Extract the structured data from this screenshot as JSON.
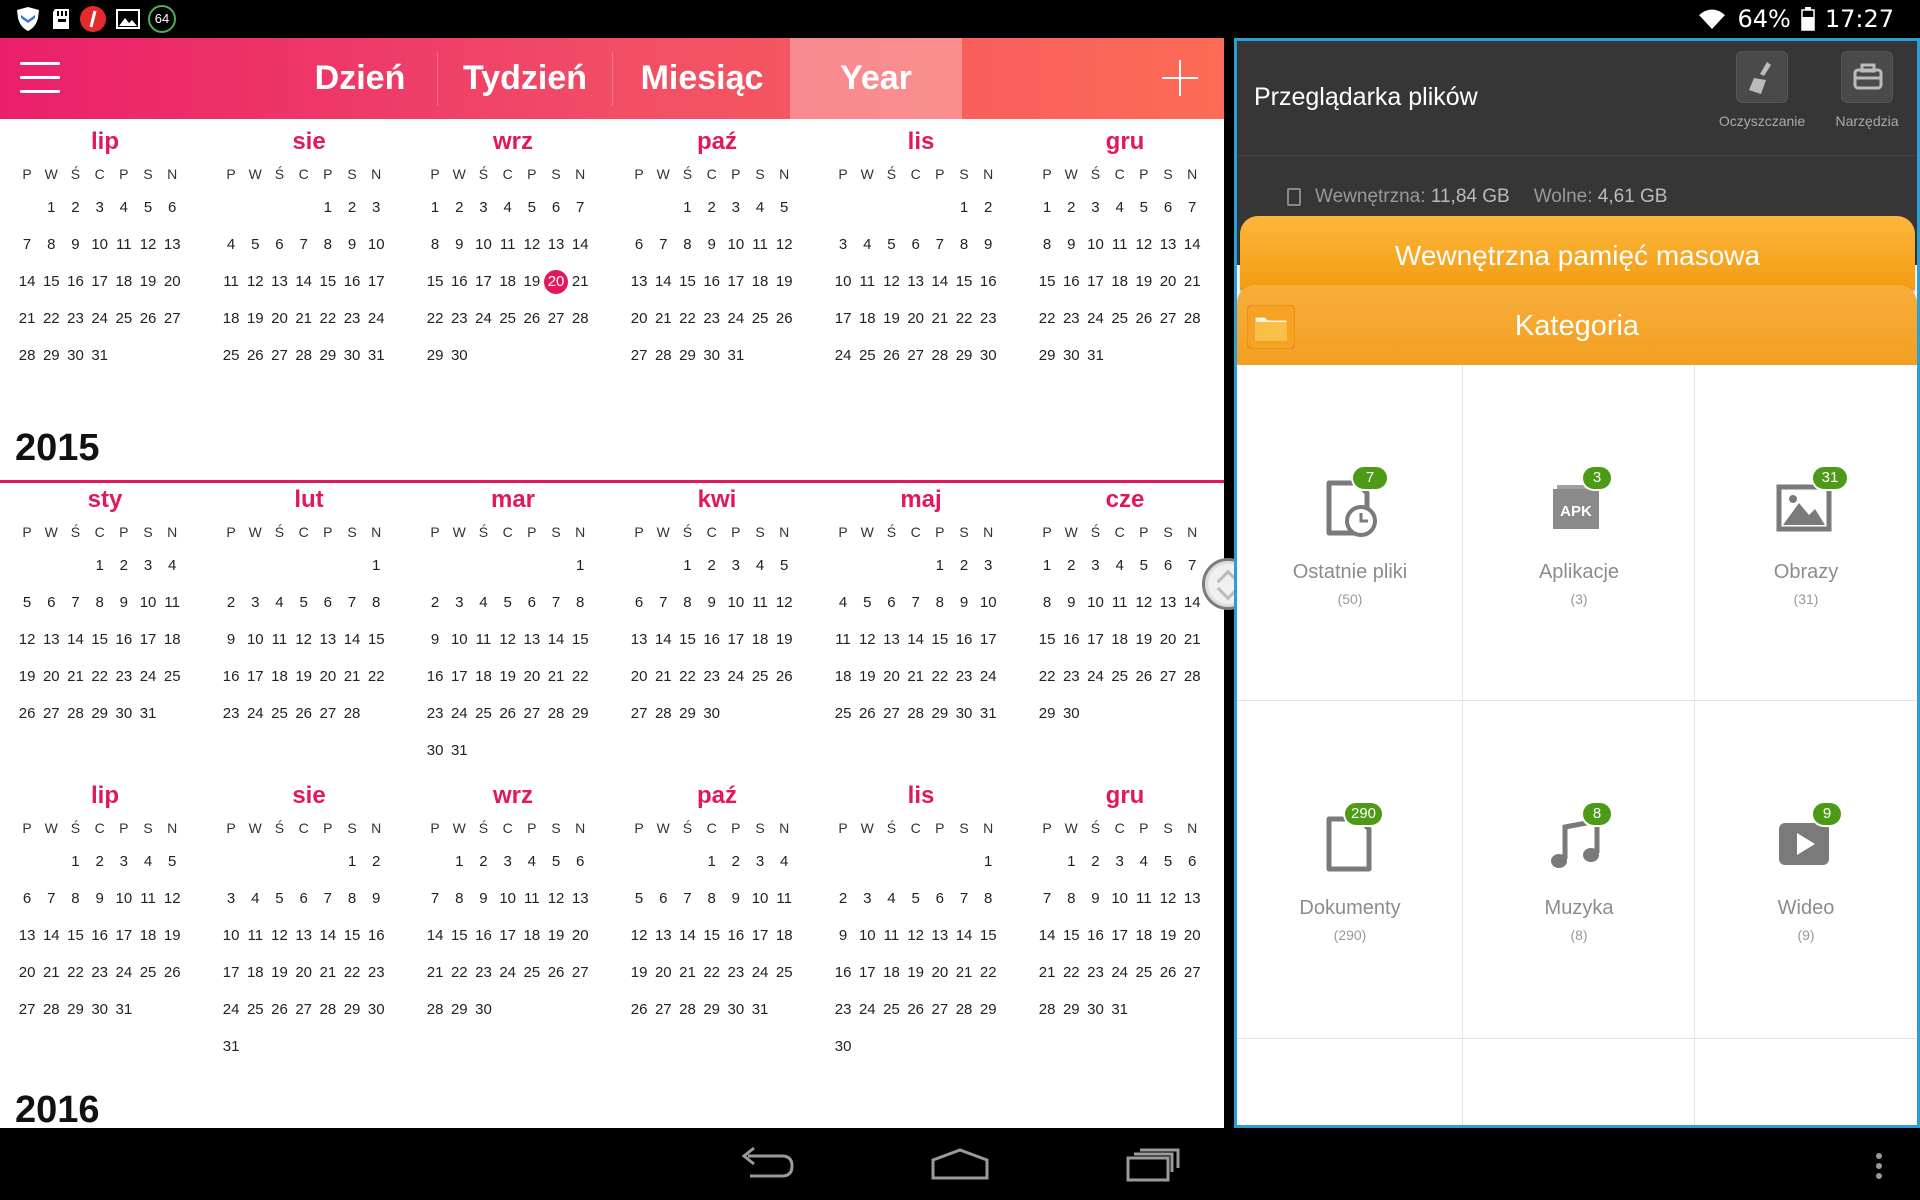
{
  "status_bar": {
    "icons": [
      "shield-app-icon",
      "sd-card-icon",
      "red-app-icon",
      "image-icon",
      "speed-64-icon"
    ],
    "badge_64": "64",
    "battery": "64%",
    "time": "17:27"
  },
  "calendar": {
    "tabs": [
      {
        "label": "Dzień"
      },
      {
        "label": "Tydzień"
      },
      {
        "label": "Miesiąc"
      },
      {
        "label": "Year"
      }
    ],
    "active_tab": "Year",
    "accent_color": "#e2175e",
    "weekday_headers": [
      "P",
      "W",
      "Ś",
      "C",
      "P",
      "S",
      "N"
    ],
    "years": [
      {
        "title": "2015"
      },
      {
        "title": "2016"
      }
    ],
    "months": [
      {
        "name": "lip",
        "start": 1,
        "days": 31
      },
      {
        "name": "sie",
        "start": 4,
        "days": 31
      },
      {
        "name": "wrz",
        "start": 0,
        "days": 30,
        "today": 20
      },
      {
        "name": "paź",
        "start": 2,
        "days": 31
      },
      {
        "name": "lis",
        "start": 5,
        "days": 30
      },
      {
        "name": "gru",
        "start": 0,
        "days": 31
      },
      {
        "name": "sty",
        "start": 3,
        "days": 31
      },
      {
        "name": "lut",
        "start": 6,
        "days": 28
      },
      {
        "name": "mar",
        "start": 6,
        "days": 31
      },
      {
        "name": "kwi",
        "start": 2,
        "days": 30
      },
      {
        "name": "maj",
        "start": 4,
        "days": 31
      },
      {
        "name": "cze",
        "start": 0,
        "days": 30
      },
      {
        "name": "lip",
        "start": 2,
        "days": 31
      },
      {
        "name": "sie",
        "start": 5,
        "days": 31
      },
      {
        "name": "wrz",
        "start": 1,
        "days": 30
      },
      {
        "name": "paź",
        "start": 3,
        "days": 31
      },
      {
        "name": "lis",
        "start": 6,
        "days": 30
      },
      {
        "name": "gru",
        "start": 1,
        "days": 31
      }
    ]
  },
  "file_manager": {
    "title": "Przeglądarka plików",
    "tools": [
      {
        "label": "Oczyszczanie",
        "icon": "broom-icon"
      },
      {
        "label": "Narzędzia",
        "icon": "toolbox-icon"
      }
    ],
    "storage_label": "Wewnętrzna:",
    "storage_total": "11,84 GB",
    "free_label": "Wolne:",
    "free_value": "4,61 GB",
    "storage_bar": "Wewnętrzna pamięć masowa",
    "category_bar": "Kategoria",
    "categories": [
      {
        "name": "Ostatnie pliki",
        "count": "(50)",
        "badge": "7",
        "icon": "recent-files-icon"
      },
      {
        "name": "Aplikacje",
        "count": "(3)",
        "badge": "3",
        "icon": "apk-icon"
      },
      {
        "name": "Obrazy",
        "count": "(31)",
        "badge": "31",
        "icon": "images-icon"
      },
      {
        "name": "Dokumenty",
        "count": "(290)",
        "badge": "290",
        "icon": "documents-icon"
      },
      {
        "name": "Muzyka",
        "count": "(8)",
        "badge": "8",
        "icon": "music-icon"
      },
      {
        "name": "Wideo",
        "count": "(9)",
        "badge": "9",
        "icon": "video-icon"
      }
    ],
    "border_color": "#2a9fd6",
    "badge_color": "#4c9a16"
  },
  "nav_bar": {
    "buttons": [
      "back-icon",
      "home-icon",
      "recents-icon",
      "overflow-menu-icon"
    ]
  }
}
